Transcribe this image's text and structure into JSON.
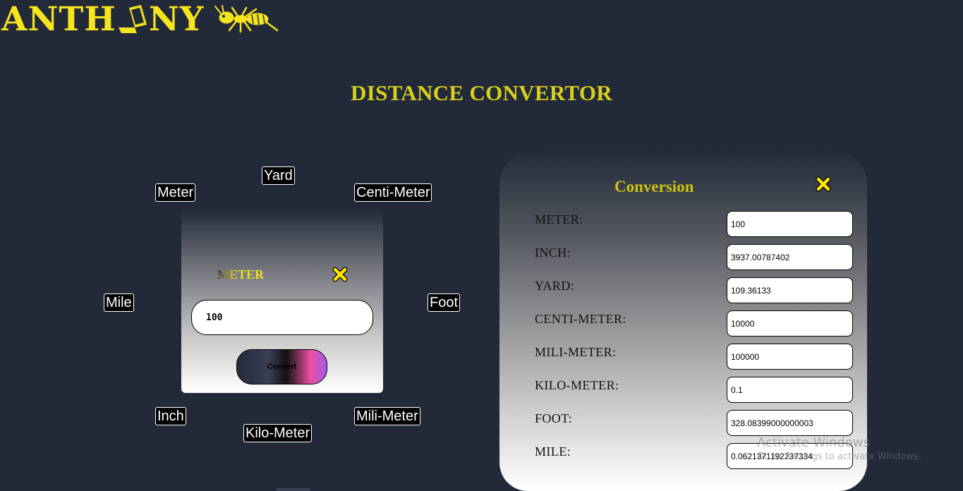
{
  "logo": {
    "text_pre": "ANTH",
    "text_post": "NY"
  },
  "page_title": "DISTANCE CONVERTOR",
  "unit_chips": {
    "meter": "Meter",
    "yard": "Yard",
    "centimeter": "Centi-Meter",
    "mile": "Mile",
    "foot": "Foot",
    "inch": "Inch",
    "kilometer": "Kilo-Meter",
    "millimeter": "Mili-Meter"
  },
  "converter": {
    "unit_title": "METER",
    "input_value": "100",
    "convert_label": "Convert"
  },
  "conversion": {
    "title": "Conversion",
    "rows": [
      {
        "label": "METER:",
        "value": "100"
      },
      {
        "label": "INCH:",
        "value": "3937.00787402"
      },
      {
        "label": "YARD:",
        "value": "109.36133"
      },
      {
        "label": "CENTI-METER:",
        "value": "10000"
      },
      {
        "label": "MILI-METER:",
        "value": "100000"
      },
      {
        "label": "KILO-METER:",
        "value": "0.1"
      },
      {
        "label": "FOOT:",
        "value": "328.08399000000003"
      },
      {
        "label": "MILE:",
        "value": "0.0621371192237334"
      }
    ]
  },
  "watermark": {
    "line1": "Activate Windows",
    "line2": "Go to Settings to activate Windows."
  },
  "colors": {
    "background": "#222a3a",
    "accent_yellow": "#f6e41c",
    "title_yellow": "#d8d01a"
  },
  "icons": {
    "logo_laptop": "laptop-icon",
    "logo_ant": "ant-icon",
    "close": "close-x-icon"
  }
}
